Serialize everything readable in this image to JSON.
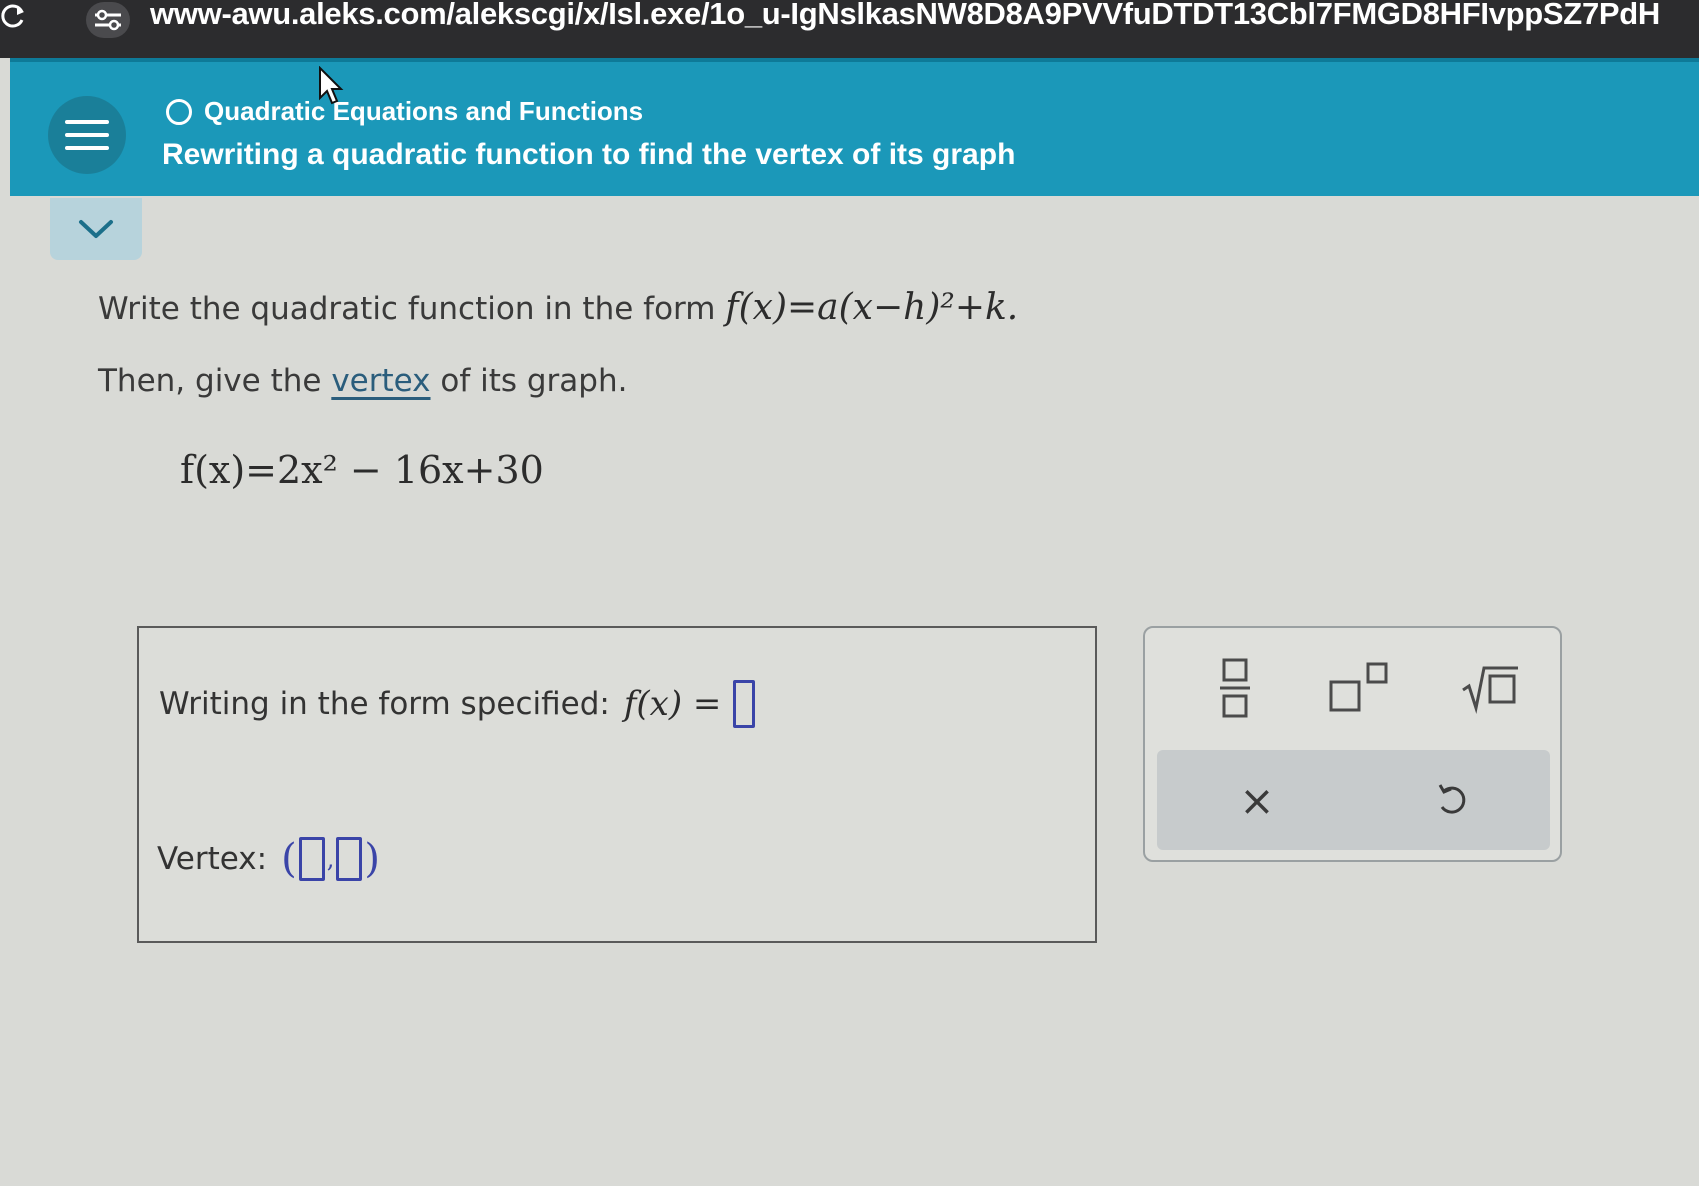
{
  "browser": {
    "url": "www-awu.aleks.com/alekscgi/x/Isl.exe/1o_u-IgNslkasNW8D8A9PVVfuDTDT13Cbl7FMGD8HFIvppSZ7PdH"
  },
  "header": {
    "topic": "Quadratic Equations and Functions",
    "subtitle": "Rewriting a quadratic function to find the vertex of its graph"
  },
  "question": {
    "line1_prefix": "Write the quadratic function in the form ",
    "line1_formula": "f(x)=a(x−h)²+k.",
    "line2_prefix": "Then, give the ",
    "line2_link": "vertex",
    "line2_suffix": " of its graph.",
    "function": "f(x)=2x² − 16x+30"
  },
  "answer": {
    "form_label": "Writing in the form specified:",
    "form_lhs": "f(x) =",
    "vertex_label": "Vertex:",
    "vertex_open": "(",
    "vertex_comma": ",",
    "vertex_close": ")"
  },
  "keypad": {
    "buttons": [
      "fraction-icon",
      "exponent-icon",
      "square-root-icon",
      "clear-icon",
      "undo-icon"
    ],
    "clear_symbol": "×"
  }
}
